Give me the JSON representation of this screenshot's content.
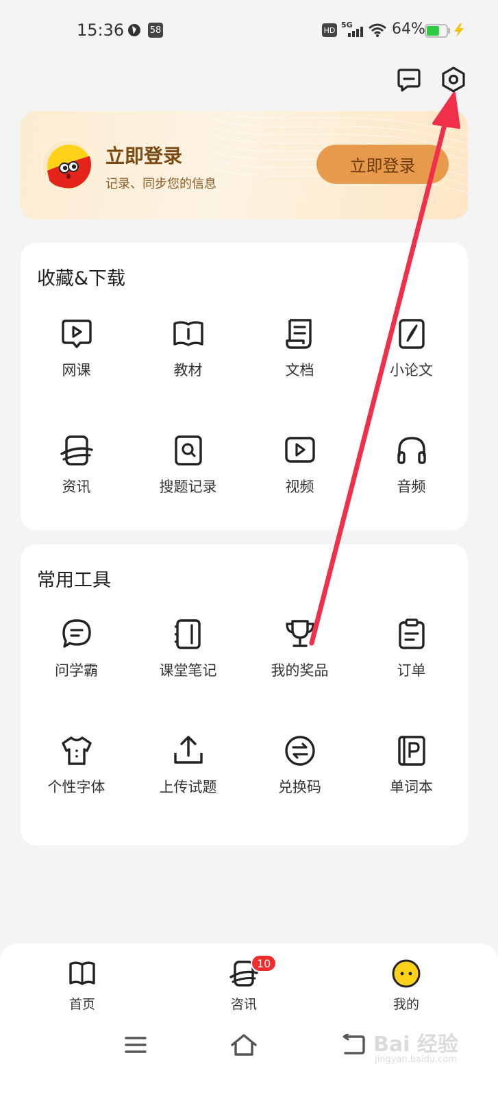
{
  "status_bar": {
    "time": "15:36",
    "badge_num": "58",
    "hd": "HD",
    "network": "5G",
    "battery_percent": "64%",
    "battery_level": 0.64,
    "battery_color": "#2ecc40"
  },
  "header": {
    "message_icon": "message-icon",
    "settings_icon": "settings-gear-icon"
  },
  "login": {
    "title": "立即登录",
    "subtitle": "记录、同步您的信息",
    "button": "立即登录",
    "button_color": "#e89a4c"
  },
  "favorites": {
    "title": "收藏&下载",
    "items": [
      {
        "label": "网课",
        "icon": "video-course-icon"
      },
      {
        "label": "教材",
        "icon": "book-icon"
      },
      {
        "label": "文档",
        "icon": "document-icon"
      },
      {
        "label": "小论文",
        "icon": "pen-paper-icon"
      },
      {
        "label": "资讯",
        "icon": "news-icon"
      },
      {
        "label": "搜题记录",
        "icon": "search-record-icon"
      },
      {
        "label": "视频",
        "icon": "video-icon"
      },
      {
        "label": "音频",
        "icon": "headphones-icon"
      }
    ]
  },
  "tools": {
    "title": "常用工具",
    "items": [
      {
        "label": "问学霸",
        "icon": "chat-bubble-icon"
      },
      {
        "label": "课堂笔记",
        "icon": "notebook-icon"
      },
      {
        "label": "我的奖品",
        "icon": "trophy-icon"
      },
      {
        "label": "订单",
        "icon": "clipboard-icon"
      },
      {
        "label": "个性字体",
        "icon": "shirt-icon"
      },
      {
        "label": "上传试题",
        "icon": "upload-icon"
      },
      {
        "label": "兑换码",
        "icon": "exchange-icon"
      },
      {
        "label": "单词本",
        "icon": "word-book-icon"
      }
    ]
  },
  "bottom_nav": {
    "tabs": [
      {
        "label": "首页",
        "icon": "home-book-icon"
      },
      {
        "label": "咨讯",
        "icon": "news-tab-icon",
        "badge": "10"
      },
      {
        "label": "我的",
        "icon": "profile-face-icon"
      }
    ],
    "badge_color": "#ef2d2d"
  },
  "watermark": {
    "text": "Bai 经验",
    "sub": "jingyan.baidu.com"
  },
  "annotation": {
    "arrow_color": "#f0304a"
  }
}
